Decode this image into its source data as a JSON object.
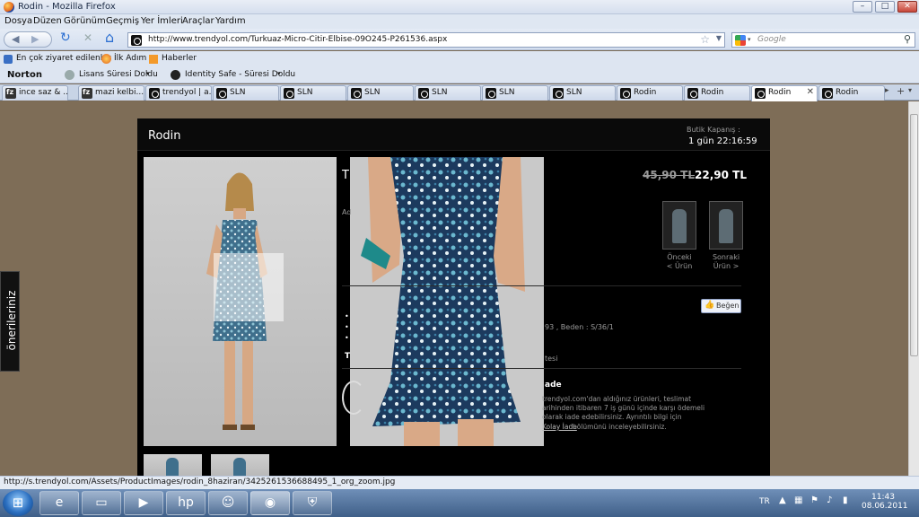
{
  "window": {
    "title": "Rodin - Mozilla Firefox",
    "min": "–",
    "max": "□",
    "close": "✕"
  },
  "menu": [
    "Dosya",
    "Düzen",
    "Görünüm",
    "Geçmiş",
    "Yer İmleri",
    "Araçlar",
    "Yardım"
  ],
  "nav": {
    "url": "http://www.trendyol.com/Turkuaz-Micro-Citir-Elbise-09O245-P261536.aspx",
    "search_placeholder": "Google",
    "back": "◀",
    "forward": "▶",
    "reload": "↻",
    "stop": "✕",
    "home": "⌂"
  },
  "bookmarks": [
    "En çok ziyaret edilenler",
    "İlk Adım",
    "Haberler"
  ],
  "norton": {
    "brand": "Norton",
    "item1": "Lisans Süresi Doldu",
    "item2": "Identity Safe - Süresi Doldu"
  },
  "tabs": [
    {
      "label": "ince saz & ...",
      "icon": "fz"
    },
    {
      "label": "mazi kelbi...",
      "icon": "fz"
    },
    {
      "label": "trendyol | a...",
      "icon": "cr"
    },
    {
      "label": "SLN",
      "icon": "cr"
    },
    {
      "label": "SLN",
      "icon": "cr"
    },
    {
      "label": "SLN",
      "icon": "cr"
    },
    {
      "label": "SLN",
      "icon": "cr"
    },
    {
      "label": "SLN",
      "icon": "cr"
    },
    {
      "label": "SLN",
      "icon": "cr"
    },
    {
      "label": "Rodin",
      "icon": "cr"
    },
    {
      "label": "Rodin",
      "icon": "cr"
    },
    {
      "label": "Rodin",
      "icon": "cr",
      "active": true
    },
    {
      "label": "Rodin",
      "icon": "cr"
    }
  ],
  "page": {
    "brand": "Rodin",
    "butik_label": "Butik Kapanış :",
    "countdown": "1 gün 22:16:59",
    "title_fragment": "T",
    "old_price": "45,90 TL",
    "new_price": "22,90 TL",
    "prev_label": "Önceki\n< Ürün",
    "next_label": "Sonraki\nÜrün >",
    "like": "Beğen",
    "sizes_text": "93 , Beden : S/36/1",
    "tab_text": "tesi",
    "t_frag": "T",
    "ad_frag": "Ad",
    "return_title": "ade",
    "return_text": "trendyol.com'dan aldığınız ürünleri, teslimat\narihinden itibaren 7 iş günü içinde karşı ödemeli\nolarak iade edebilirsiniz. Ayrıntılı bilgi için",
    "return_link": "Kolay İade",
    "return_tail": " bölümünü inceleyebilirsiniz.",
    "side_tab": "önerileriniz"
  },
  "status": "http://s.trendyol.com/Assets/ProductImages/rodin_8haziran/3425261536688495_1_org_zoom.jpg",
  "taskbar": {
    "lang": "TR",
    "time": "11:43",
    "date": "08.06.2011"
  }
}
